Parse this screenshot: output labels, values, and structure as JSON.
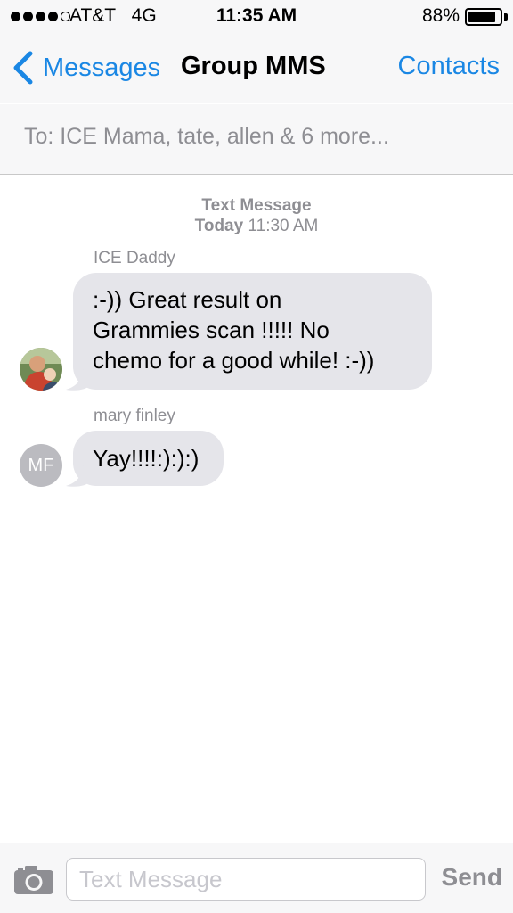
{
  "status_bar": {
    "signal_bars_filled": 4,
    "signal_bars_total": 5,
    "carrier": "AT&T",
    "network": "4G",
    "time": "11:35 AM",
    "battery_percent": "88%",
    "battery_level": 0.88
  },
  "nav": {
    "back_label": "Messages",
    "title": "Group MMS",
    "contacts_label": "Contacts"
  },
  "to_field": {
    "text": "To: ICE Mama, tate, allen & 6 more..."
  },
  "conversation": {
    "timestamp_type": "Text Message",
    "timestamp_day": "Today",
    "timestamp_time": "11:30 AM",
    "messages": [
      {
        "sender": "ICE Daddy",
        "lines": [
          ":-)) Great result on",
          "Grammies scan !!!!! No",
          "chemo for a good while! :-))"
        ],
        "avatar_type": "photo"
      },
      {
        "sender": "mary finley",
        "lines": [
          "Yay!!!!:):):)"
        ],
        "avatar_initials": "MF"
      }
    ]
  },
  "input_bar": {
    "placeholder": "Text Message",
    "send_label": "Send"
  },
  "colors": {
    "accent": "#1a87e4",
    "bubble_received": "#e5e5ea",
    "secondary_text": "#8e8e93",
    "bar_background": "#f7f7f8"
  },
  "icons": [
    "back-chevron-icon",
    "camera-icon",
    "battery-icon",
    "signal-icon"
  ]
}
